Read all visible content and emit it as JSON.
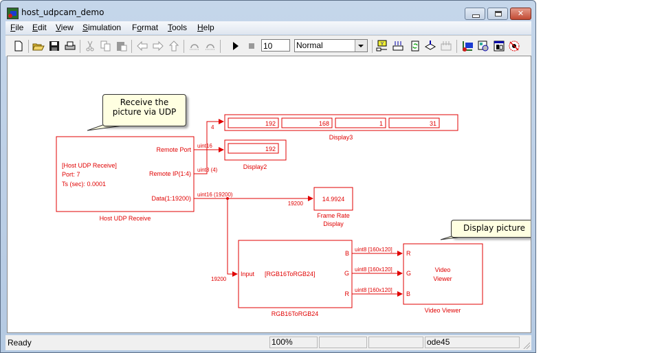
{
  "window": {
    "title": "host_udpcam_demo"
  },
  "menu": [
    {
      "label": "File",
      "accel": "F"
    },
    {
      "label": "Edit",
      "accel": "E"
    },
    {
      "label": "View",
      "accel": "V"
    },
    {
      "label": "Simulation",
      "accel": "S"
    },
    {
      "label": "Format",
      "accel": "o"
    },
    {
      "label": "Tools",
      "accel": "T"
    },
    {
      "label": "Help",
      "accel": "H"
    }
  ],
  "toolbar": {
    "stop_time": "10",
    "sim_mode": "Normal",
    "icons": [
      "new-model-icon",
      "open-icon",
      "save-icon",
      "print-icon",
      "cut-icon",
      "copy-icon",
      "paste-icon",
      "back-icon",
      "forward-icon",
      "up-icon",
      "undo-icon",
      "redo-icon",
      "start-simulation-icon",
      "stop-simulation-icon",
      "library-browser-icon",
      "update-diagram-icon",
      "build-icon",
      "incremental-build-icon",
      "model-explorer-icon",
      "debug-icon",
      "model-advisor-icon",
      "profiler-icon"
    ]
  },
  "callouts": {
    "receive": "Receive the picture via UDP",
    "receive_line1": "Receive the",
    "receive_line2": "picture via UDP",
    "display": "Display picture"
  },
  "diagram": {
    "color": "#e00000",
    "udp_block": {
      "name": "Host UDP Receive",
      "content": [
        "[Host UDP Receive]",
        "Port: 7",
        "Ts (sec): 0.0001"
      ],
      "ports": [
        "Remote Port",
        "Remote IP(1:4)",
        "Data(1:19200)"
      ]
    },
    "display3": {
      "name": "Display3",
      "values": [
        "192",
        "168",
        "1",
        "31"
      ]
    },
    "display2": {
      "name": "Display2",
      "value": "192"
    },
    "frame_rate": {
      "name_line1": "Frame Rate",
      "name_line2": "Display",
      "value": "14.9924"
    },
    "rgb_block": {
      "name": "RGB16ToRGB24",
      "content": "[RGB16ToRGB24]",
      "in_port": "Input",
      "out_ports": [
        "B",
        "G",
        "R"
      ]
    },
    "video_viewer": {
      "name": "Video Viewer",
      "content_line1": "Video",
      "content_line2": "Viewer",
      "in_ports": [
        "R",
        "G",
        "B"
      ]
    },
    "signals": {
      "ip_width": "4",
      "remote_port_type": "uint16",
      "remote_ip_type": "uint8 (4)",
      "data_type": "uint16 (19200)",
      "frame_width": "19200",
      "rgb_in_width": "19200",
      "rgb_out_type": "uint8 [160x120]"
    }
  },
  "status": {
    "message": "Ready",
    "zoom": "100%",
    "cell2": "",
    "cell3": "",
    "solver": "ode45"
  }
}
